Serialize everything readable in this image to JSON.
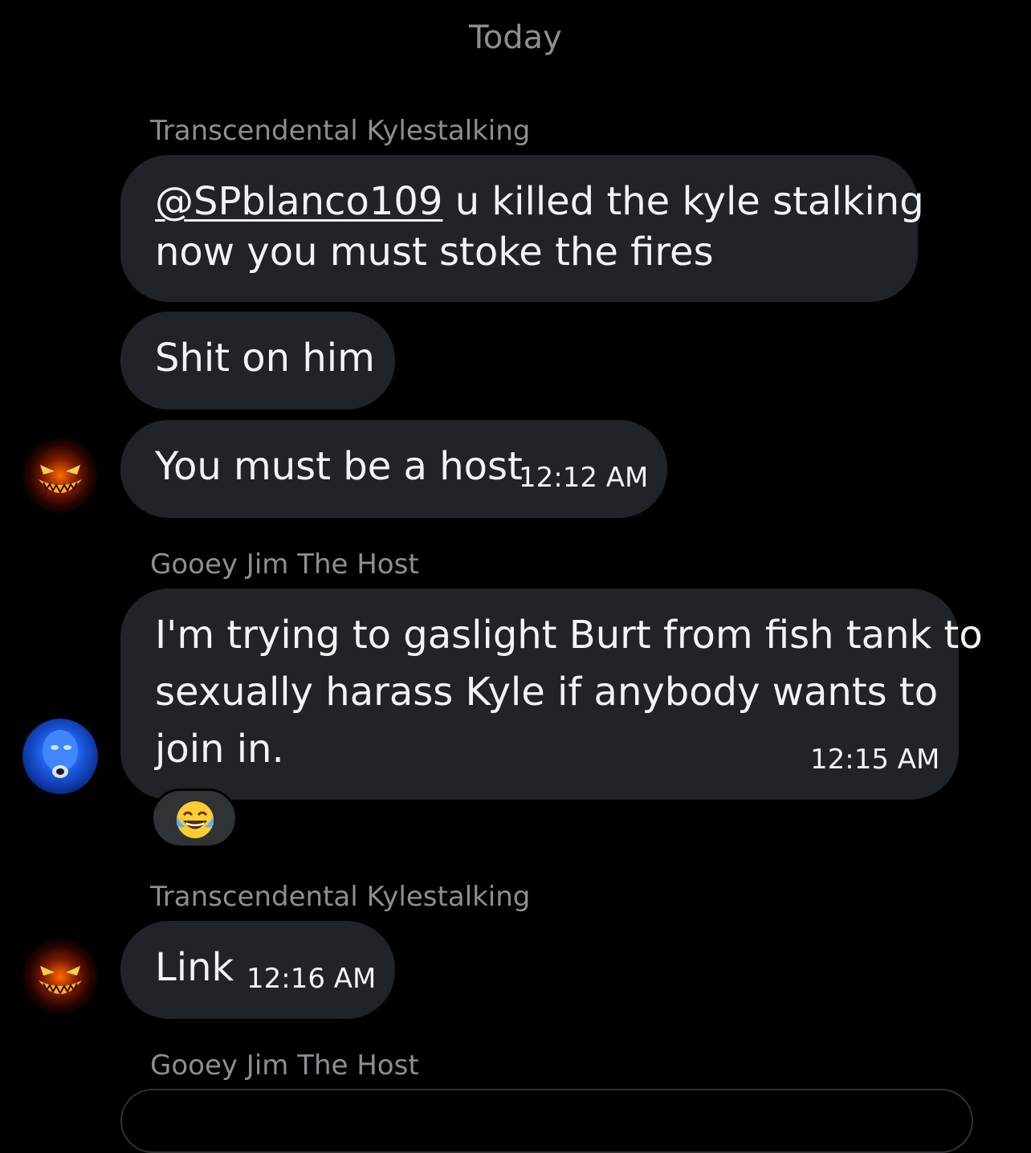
{
  "date_separator": "Today",
  "messages": [
    {
      "sender": "Transcendental Kylestalking",
      "mention": "@SPblanco109",
      "line1_rest": " u killed the kyle stalking",
      "line2": "now you must stoke the fires"
    },
    {
      "text": "Shit on him"
    },
    {
      "text": "You must be a host",
      "time": "12:12 AM"
    },
    {
      "sender": "Gooey Jim The Host",
      "line1": "I'm trying to gaslight Burt from fish tank to",
      "line2": "sexually harass Kyle if anybody wants to",
      "line3": "join in.",
      "time": "12:15 AM",
      "reaction": "face-with-tears-of-joy"
    },
    {
      "sender": "Transcendental Kylestalking",
      "text": "Link",
      "time": "12:16 AM"
    },
    {
      "sender": "Gooey Jim The Host"
    }
  ],
  "colors": {
    "background": "#000000",
    "bubble": "#202327",
    "meta_text": "#8b8f94",
    "message_text": "#f2f3f4"
  }
}
